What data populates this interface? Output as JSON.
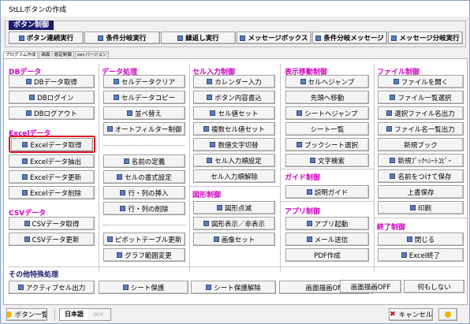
{
  "window": {
    "title": "StLLボタンの作成"
  },
  "toolbar": {
    "group_label": "ボタン制御",
    "buttons": [
      "ボタン連続実行",
      "条件分岐実行",
      "繰返し実行",
      "メッセージボックス",
      "条件分岐メッセージ",
      "メッセージ分岐実行"
    ]
  },
  "tabs": [
    "プログラム作成",
    "画面・設定制御",
    "ver.バージョン"
  ],
  "columns": {
    "c1": {
      "db": {
        "title": "DBデータ",
        "buttons": [
          "DBデータ取得",
          "DBログイン",
          "DBログアウト"
        ]
      },
      "excel": {
        "title": "Excelデータ",
        "buttons": [
          "Excelデータ取得",
          "Excelデータ抽出",
          "Excelデータ更新",
          "Excelデータ削除"
        ]
      },
      "csv": {
        "title": "CSVデータ",
        "buttons": [
          "CSVデータ取得",
          "CSVデータ更新"
        ]
      }
    },
    "c2": {
      "title": "データ処理",
      "buttons_a": [
        "セルデータクリア",
        "セルデータコピー",
        "並べ替え",
        "オートフィルター制御"
      ],
      "buttons_b": [
        "名前の定義",
        "セルの書式設定",
        "行・列の挿入",
        "行・列の削除"
      ],
      "buttons_c": [
        "ピボットテーブル更新",
        "グラフ範囲変更"
      ]
    },
    "c3": {
      "title": "セル入力制御",
      "buttons": [
        "カレンダー入力",
        "ボタン内容書込",
        "セル値セット",
        "複数セル値セット",
        "数値文字切替",
        "セル入力順設定",
        "セル入力順解除"
      ],
      "fig_title": "図形制御",
      "fig_buttons": [
        "図形点滅",
        "図形表示／非表示",
        "画像セット"
      ]
    },
    "c4": {
      "title": "表示移動制御",
      "buttons": [
        "セルへジャンプ",
        "先頭へ移動",
        "シートへジャンプ",
        "シート一覧",
        "ブックシート選択",
        "文字検索"
      ],
      "guide_title": "ガイド制御",
      "guide_buttons": [
        "説明ガイド"
      ],
      "app_title": "アプリ制御",
      "app_buttons": [
        "アプリ起動",
        "メール送信",
        "PDF作成"
      ]
    },
    "c5": {
      "title": "ファイル制御",
      "buttons": [
        "ファイルを開く",
        "ファイル一覧選択",
        "選択ファイル名出力",
        "ファイル名一覧出力",
        "新規ブック",
        "新規ﾌﾞｯｸﾍｼｰﾄｺﾋﾟｰ",
        "名前をつけて保存",
        "上書保存",
        "印刷"
      ],
      "end_title": "終了制御",
      "end_buttons": [
        "閉じる",
        "Excel終了"
      ]
    }
  },
  "other": {
    "title": "その他特殊処理",
    "buttons": [
      "アクティブセル出力",
      "シート保護",
      "シート保護解除",
      "画面描画ON",
      "画面描画OFF",
      "何もしない"
    ]
  },
  "bottom": {
    "list_button": "ボタン一覧",
    "lang_active": "日本語",
    "lang_inactive": "ｺﾏﾝﾄﾞ",
    "cancel_button": "キャンセル"
  },
  "colors": {
    "accent_heading": "#d000c0",
    "group_label_bg": "#1c1c6e",
    "highlight": "#e0141e"
  }
}
